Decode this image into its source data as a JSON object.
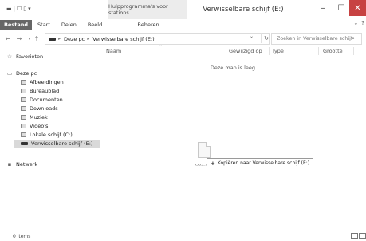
{
  "titlebar": {
    "title": "Verwisselbare schijf (E:)",
    "context_tool": "Hulpprogramma's voor stations",
    "minimize": "–",
    "maximize": "☐",
    "close": "✕"
  },
  "ribbon": {
    "tabs": [
      "Bestand",
      "Start",
      "Delen",
      "Beeld"
    ],
    "context_tab": "Beheren",
    "expand": "⌄",
    "help": "?"
  },
  "address": {
    "back": "←",
    "forward": "→",
    "up": "↑",
    "crumbs": [
      "Deze pc",
      "Verwisselbare schijf (E:)"
    ],
    "dropdown": "⌄",
    "refresh": "↻"
  },
  "search": {
    "placeholder": "Zoeken in Verwisselbare schijf..."
  },
  "navigation": {
    "favorites": "Favorieten",
    "this_pc": "Deze pc",
    "items": [
      "Afbeeldingen",
      "Bureaublad",
      "Documenten",
      "Downloads",
      "Muziek",
      "Video's",
      "Lokale schijf (C:)",
      "Verwisselbare schijf (E:)"
    ],
    "network": "Netwerk"
  },
  "content": {
    "columns": [
      "Naam",
      "Gewijzigd op",
      "Type",
      "Grootte"
    ],
    "empty_message": "Deze map is leeg.",
    "drag_file_name": "xxxx.xlsx",
    "drag_tooltip": "Kopiëren naar Verwisselbare schijf (E:)"
  },
  "status": {
    "items": "0 items"
  }
}
